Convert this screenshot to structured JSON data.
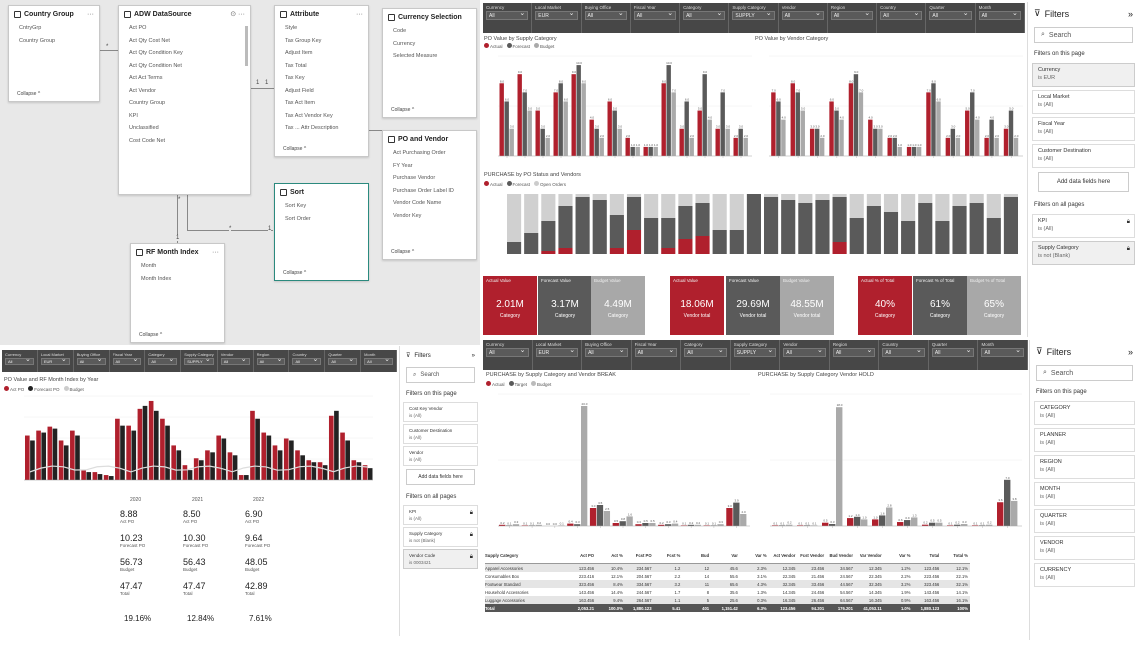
{
  "model": {
    "tables": [
      {
        "id": "country",
        "title": "Country Group",
        "fields": [
          "CntryGrp",
          "Country Group"
        ],
        "collapse": "Collapse ^"
      },
      {
        "id": "adw",
        "title": "ADW DataSource",
        "fields": [
          "Act PO",
          "Act Qty Cost Net",
          "Act Qty Condition Key",
          "Act Qty Condition Net",
          "Act Act Terms",
          "Act Vendor",
          "Country Group",
          "KPI",
          "Unclassified",
          "Cost Code Net"
        ],
        "collapse": ""
      },
      {
        "id": "attribute",
        "title": "Attribute",
        "fields": [
          "Style",
          "Tax Group Key",
          "Adjust Item",
          "Tax Total",
          "Tax Key",
          "Adjust Field",
          "Tax Act Item",
          "Tax Act Vendor Key",
          "Tax ... Attr Description"
        ],
        "collapse": "Collapse ^"
      },
      {
        "id": "currency",
        "title": "Currency Selection",
        "fields": [
          "Code",
          "Currency",
          "Selected Measure"
        ],
        "collapse": "Collapse ^"
      },
      {
        "id": "po",
        "title": "PO and Vendor",
        "fields": [
          "Act Purchasing Order",
          "FY Year",
          "Purchase Vendor",
          "Purchase Order Label ID",
          "Vendor Code Name",
          "Vendor Key"
        ],
        "collapse": "Collapse ^"
      },
      {
        "id": "sort",
        "title": "Sort",
        "fields": [
          "Sort Key",
          "Sort Order"
        ],
        "collapse": "Collapse ^"
      },
      {
        "id": "month",
        "title": "RF Month Index",
        "fields": [
          "Month",
          "Month Index"
        ],
        "collapse": "Collapse ^"
      }
    ],
    "markers": [
      "*",
      "1",
      "1",
      "*",
      "1",
      "*",
      "1"
    ]
  },
  "slicers_top": {
    "labels": [
      "Currency",
      "Local Market",
      "Buying Office",
      "Fiscal Year",
      "Category",
      "Supply Category",
      "Vendor",
      "Region",
      "Country",
      "Quarter",
      "Month"
    ],
    "values": [
      "All",
      "EUR",
      "All",
      "All",
      "All",
      "SUPPLY",
      "All",
      "All",
      "All",
      "All",
      "All"
    ]
  },
  "slicers_mid": {
    "labels": [
      "Currency",
      "Local Market",
      "Buying Office",
      "Fiscal Year",
      "Category",
      "Supply Category",
      "Vendor",
      "Region",
      "Country",
      "Quarter",
      "Month"
    ],
    "values": [
      "All",
      "EUR",
      "All",
      "All",
      "All",
      "SUPPLY",
      "All",
      "All",
      "All",
      "All",
      "All"
    ]
  },
  "slicers_left": {
    "labels": [
      "Currency",
      "Local Market",
      "Buying Office",
      "Fiscal Year",
      "Category",
      "Supply Category",
      "Vendor",
      "Region",
      "Country",
      "Quarter",
      "Month"
    ],
    "values": [
      "All",
      "EUR",
      "All",
      "All",
      "All",
      "SUPPLY",
      "All",
      "All",
      "All",
      "All",
      "All"
    ]
  },
  "charts": {
    "c1_title": "PO Value by Supply Category",
    "c1_legend": [
      "Actual",
      "Forecast",
      "Budget"
    ],
    "c2_title": "PO Value by Vendor Category",
    "c3_title": "PURCHASE by PO Status and Vendors",
    "c3_legend": [
      "Actual",
      "Forecast",
      "Open Orders"
    ],
    "c4_title": "PURCHASE by Supply Category and Vendor BREAK",
    "c5_title": "PURCHASE by Supply Category Vendor HOLD",
    "c45_legend": [
      "Actual",
      "Target",
      "Budget"
    ],
    "left_title": "PO Value and RF Month Index by Year",
    "left_legend": [
      "Act PO",
      "Forecast PO",
      "Budget"
    ],
    "years": [
      "2020",
      "2021",
      "2022"
    ]
  },
  "kpis": [
    {
      "h": "Actual Value",
      "v": "2.01M",
      "s": "Category",
      "c": "#b0202d"
    },
    {
      "h": "Forecast Value",
      "v": "3.17M",
      "s": "Category",
      "c": "#5a5a5a"
    },
    {
      "h": "Budget Value",
      "v": "4.49M",
      "s": "Category",
      "c": "#a8a8a8"
    },
    {
      "h": "Actual Value",
      "v": "18.06M",
      "s": "Vendor total",
      "c": "#b0202d"
    },
    {
      "h": "Forecast Value",
      "v": "29.69M",
      "s": "Vendor total",
      "c": "#5a5a5a"
    },
    {
      "h": "Budget Value",
      "v": "48.55M",
      "s": "Vendor total",
      "c": "#a8a8a8"
    },
    {
      "h": "Actual % of Total",
      "v": "40%",
      "s": "Category",
      "c": "#b0202d"
    },
    {
      "h": "Forecast % of Total",
      "v": "61%",
      "s": "Category",
      "c": "#5a5a5a"
    },
    {
      "h": "Budget % of Total",
      "v": "65%",
      "s": "Category",
      "c": "#a8a8a8"
    }
  ],
  "left_kpis": [
    {
      "v": "8.88",
      "l": "Act PO"
    },
    {
      "v": "10.23",
      "l": "Forecast PO"
    },
    {
      "v": "56.73",
      "l": "Budget"
    },
    {
      "v": "47.47",
      "l": "Total"
    },
    {
      "v": "19.16%",
      "l": ""
    },
    {
      "v": "8.50",
      "l": "Act PO"
    },
    {
      "v": "10.30",
      "l": "Forecast PO"
    },
    {
      "v": "56.43",
      "l": "Budget"
    },
    {
      "v": "47.47",
      "l": "Total"
    },
    {
      "v": "12.84%",
      "l": ""
    },
    {
      "v": "6.90",
      "l": "Act PO"
    },
    {
      "v": "9.64",
      "l": "Forecast PO"
    },
    {
      "v": "48.05",
      "l": "Budget"
    },
    {
      "v": "42.89",
      "l": "Total"
    },
    {
      "v": "7.61%",
      "l": ""
    }
  ],
  "filters1": {
    "title": "Filters",
    "search": "Search",
    "on_page": "Filters on this page",
    "cards": [
      {
        "name": "Currency",
        "val": "is EUR"
      },
      {
        "name": "Local Market",
        "val": "is (All)"
      },
      {
        "name": "Fiscal Year",
        "val": "is (All)"
      },
      {
        "name": "Customer Destination",
        "val": "is (All)"
      }
    ],
    "add": "Add data fields here",
    "all_pages": "Filters on all pages",
    "cards2": [
      {
        "name": "KPI",
        "val": "is (All)"
      },
      {
        "name": "Supply Category",
        "val": "is not (Blank)"
      }
    ]
  },
  "filters2": {
    "title": "Filters",
    "search": "Search",
    "on_page": "Filters on this page",
    "cards": [
      {
        "name": "Cost Key Vendor",
        "val": "is (All)"
      },
      {
        "name": "Customer Destination",
        "val": "is (All)"
      },
      {
        "name": "Vendor",
        "val": "is (All)"
      }
    ],
    "add": "Add data fields here",
    "all_pages": "Filters on all pages",
    "cards2": [
      {
        "name": "KPI",
        "val": "is (All)"
      },
      {
        "name": "Supply Category",
        "val": "is not (Blank)"
      },
      {
        "name": "Vendor Code",
        "val": "is 0003421"
      }
    ]
  },
  "filters3": {
    "title": "Filters",
    "search": "Search",
    "on_page": "Filters on this page",
    "cards": [
      {
        "name": "CATEGORY",
        "val": "is (All)"
      },
      {
        "name": "PLANNER",
        "val": "is (All)"
      },
      {
        "name": "REGION",
        "val": "is (All)"
      },
      {
        "name": "MONTH",
        "val": "is (All)"
      },
      {
        "name": "QUARTER",
        "val": "is (All)"
      },
      {
        "name": "VENDOR",
        "val": "is (All)"
      },
      {
        "name": "CURRENCY",
        "val": "is (All)"
      }
    ]
  },
  "matrix": {
    "headers": [
      "Supply Category",
      "Act PO",
      "Act %",
      "Fcst PO",
      "Fcst %",
      "Bud",
      "Var",
      "Var %",
      "Act Vendor",
      "Fcst Vendor",
      "Bud Vendor",
      "Var Vendor",
      "Var %",
      "Total",
      "Total %"
    ],
    "rows": [
      [
        "Apparel Accessories",
        "123.456",
        "10.4%",
        "234.567",
        "1.2",
        "12",
        "45.6",
        "2.3%",
        "12.345",
        "23.456",
        "34.567",
        "12.345",
        "1.2%",
        "123.456",
        "12.1%"
      ],
      [
        "Consumables Box",
        "223.416",
        "12.1%",
        "204.567",
        "2.2",
        "14",
        "55.6",
        "3.1%",
        "22.345",
        "21.456",
        "24.567",
        "22.345",
        "2.2%",
        "223.456",
        "22.1%"
      ],
      [
        "Footwear Standard",
        "323.456",
        "8.4%",
        "334.567",
        "3.2",
        "11",
        "65.6",
        "4.3%",
        "32.345",
        "33.456",
        "44.567",
        "32.345",
        "3.2%",
        "323.456",
        "32.1%"
      ],
      [
        "Household Accessories",
        "143.456",
        "14.4%",
        "244.567",
        "1.7",
        "8",
        "35.6",
        "1.3%",
        "14.345",
        "24.456",
        "54.567",
        "14.345",
        "1.9%",
        "143.456",
        "14.1%"
      ],
      [
        "Luggage Accessories",
        "163.456",
        "9.4%",
        "264.567",
        "1.1",
        "5",
        "25.6",
        "0.3%",
        "16.345",
        "26.456",
        "64.567",
        "16.345",
        "0.9%",
        "163.456",
        "16.1%"
      ]
    ],
    "total": [
      "Total",
      "2,053.21",
      "100.0%",
      "1,880.123",
      "5.41",
      "401",
      "1,151.42",
      "6.3%",
      "123.456",
      "94.201",
      "176.201",
      "41,053.11",
      "1.0%",
      "1,880.123",
      "100%"
    ]
  }
}
